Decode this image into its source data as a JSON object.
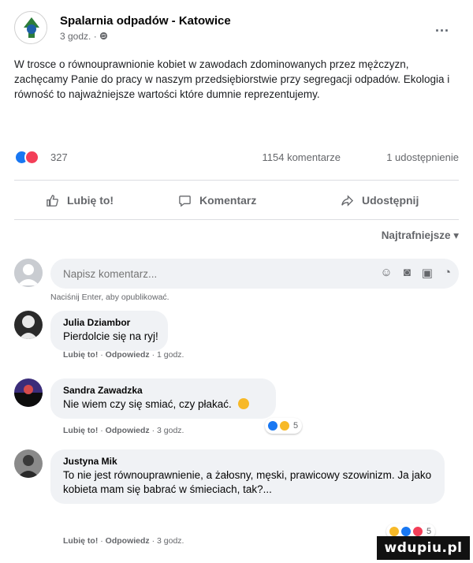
{
  "post": {
    "page_name": "Spalarnia odpadów - Katowice",
    "meta_time": "3 godz. · ",
    "more_label": "...",
    "text": "W trosce o równouprawnionie kobiet w zawodach zdominowanych przez mężczyzn, zachęcamy Panie do pracy w naszym przedsiębiorstwie przy segregacji odpadów. Ekologia i równość to najważniejsze wartości które dumnie reprezentujemy."
  },
  "stats": {
    "reactions": "327",
    "comments": "1154 komentarze",
    "shares": "1 udostępnienie"
  },
  "actions": {
    "like": "Lubię to!",
    "comment": "Komentarz",
    "share": "Udostępnij"
  },
  "sort": {
    "label": "Najtrafniejsze ▾"
  },
  "composer": {
    "placeholder": "Napisz komentarz...",
    "hint": "Naciśnij Enter, aby opublikować."
  },
  "comments": [
    {
      "author": "Julia Dziambor",
      "text": "Pierdolcie się na ryj!",
      "like": "Lubię to!",
      "reply": "Odpowiedz",
      "time": "1 godz."
    },
    {
      "author": "Sandra Zawadzka",
      "text": "Nie wiem czy się smiać, czy płakać.",
      "like": "Lubię to!",
      "reply": "Odpowiedz",
      "time": "3 godz.",
      "reaction_count": "5"
    },
    {
      "author": "Justyna Mik",
      "text": "To nie jest równouprawnienie, a żałosny, męski, prawicowy szowinizm. Ja jako kobieta mam się babrać w śmieciach, tak?...",
      "like": "Lubię to!",
      "reply": "Odpowiedz",
      "time": "3 godz.",
      "reaction_count": "5"
    }
  ],
  "watermark": "wdupiu.pl",
  "colors": {
    "like_blue": "#1877f2",
    "love_red": "#f33e58",
    "haha_yellow": "#f7b928",
    "bubble_bg": "#f0f2f5",
    "muted_text": "#65676b"
  }
}
